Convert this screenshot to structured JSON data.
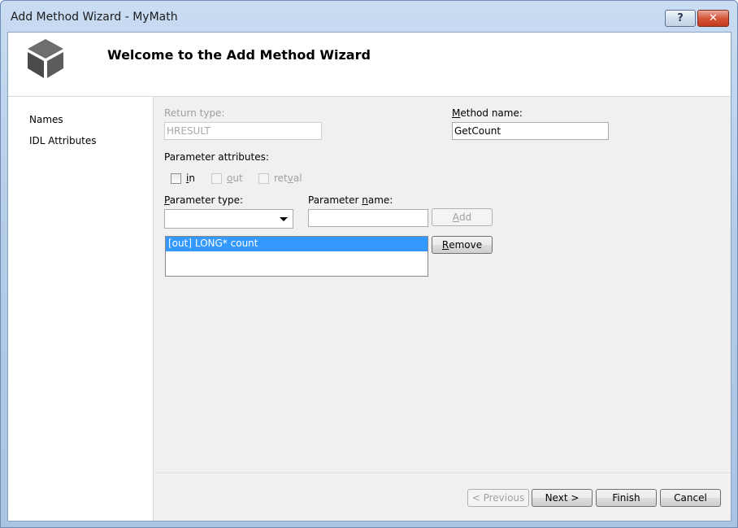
{
  "window": {
    "title": "Add Method Wizard - MyMath",
    "help_label": "?",
    "close_label": "✕"
  },
  "header": {
    "title": "Welcome to the Add Method Wizard"
  },
  "sidebar": {
    "items": [
      {
        "label": "Names"
      },
      {
        "label": "IDL Attributes"
      }
    ]
  },
  "form": {
    "return_type": {
      "label": "Return type:",
      "value": "HRESULT"
    },
    "method_name": {
      "label_prefix": "M",
      "label_rest": "ethod name:",
      "value": "GetCount"
    },
    "parameter_attributes": {
      "label": "Parameter attributes:",
      "options": [
        {
          "pre": "",
          "u": "i",
          "post": "n",
          "checked": false,
          "enabled": true
        },
        {
          "pre": "",
          "u": "o",
          "post": "ut",
          "checked": false,
          "enabled": false
        },
        {
          "pre": "ret",
          "u": "v",
          "post": "al",
          "checked": false,
          "enabled": false
        }
      ]
    },
    "parameter_type": {
      "label_prefix": "P",
      "label_rest": "arameter type:",
      "value": ""
    },
    "parameter_name": {
      "label_pre": "Parameter ",
      "label_u": "n",
      "label_post": "ame:",
      "value": ""
    },
    "add_button": {
      "pre": "",
      "u": "A",
      "post": "dd"
    },
    "parameters_list": [
      "[out] LONG* count"
    ],
    "remove_button": {
      "pre": "",
      "u": "R",
      "post": "emove"
    }
  },
  "footer": {
    "previous_label": "< Previous",
    "next_label": "Next >",
    "finish_label": "Finish",
    "cancel_label": "Cancel"
  }
}
